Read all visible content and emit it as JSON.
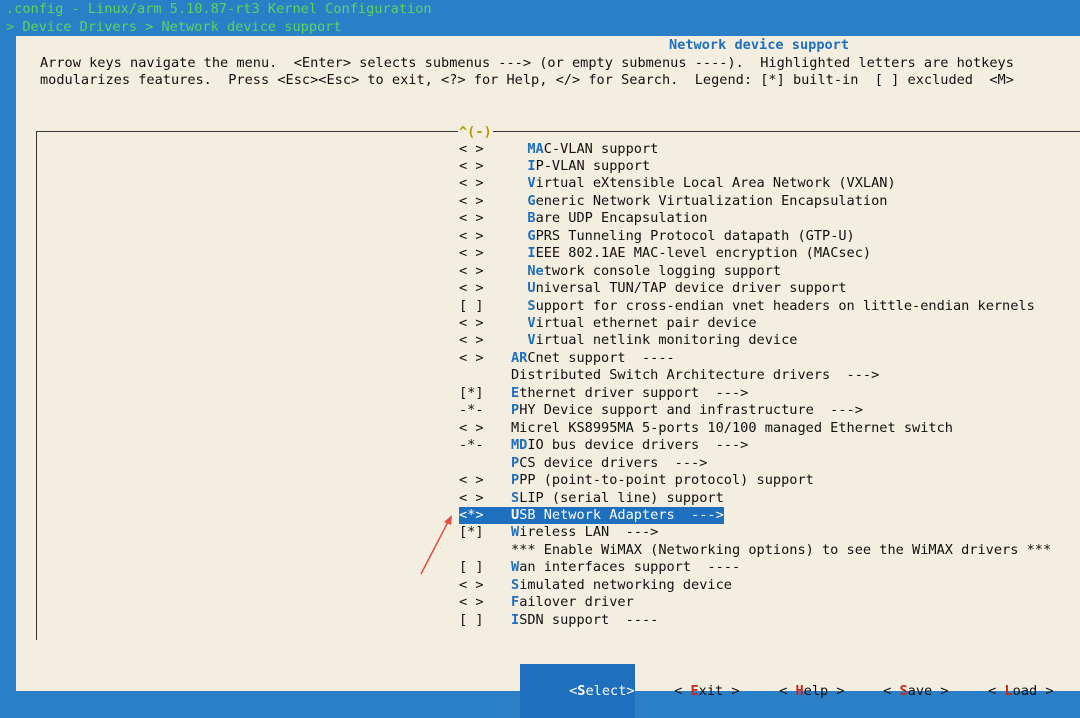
{
  "titlebar": {
    "line1": ".config - Linux/arm 5.10.87-rt3 Kernel Configuration",
    "line2": "> Device Drivers > Network device support"
  },
  "dialog": {
    "title": "Network device support",
    "help_line1": "Arrow keys navigate the menu.  <Enter> selects submenus ---> (or empty submenus ----).  Highlighted letters are hotkeys",
    "help_line2": "modularizes features.  Press <Esc><Esc> to exit, <?> for Help, </> for Search.  Legend: [*] built-in  [ ] excluded  <M>",
    "scroll_indicator": "^(-)"
  },
  "menu": {
    "items": [
      {
        "box": "< >",
        "indent": "  ",
        "hotkey": "MA",
        "rest": "C-VLAN support"
      },
      {
        "box": "< >",
        "indent": "  ",
        "hotkey": "I",
        "rest": "P-VLAN support"
      },
      {
        "box": "< >",
        "indent": "  ",
        "hotkey": "V",
        "rest": "irtual eXtensible Local Area Network (VXLAN)"
      },
      {
        "box": "< >",
        "indent": "  ",
        "hotkey": "G",
        "rest": "eneric Network Virtualization Encapsulation"
      },
      {
        "box": "< >",
        "indent": "  ",
        "hotkey": "B",
        "rest": "are UDP Encapsulation"
      },
      {
        "box": "< >",
        "indent": "  ",
        "hotkey": "G",
        "rest": "PRS Tunneling Protocol datapath (GTP-U)"
      },
      {
        "box": "< >",
        "indent": "  ",
        "hotkey": "I",
        "rest": "EEE 802.1AE MAC-level encryption (MACsec)"
      },
      {
        "box": "< >",
        "indent": "  ",
        "hotkey": "Ne",
        "rest": "twork console logging support"
      },
      {
        "box": "< >",
        "indent": "  ",
        "hotkey": "U",
        "rest": "niversal TUN/TAP device driver support"
      },
      {
        "box": "[ ]",
        "indent": "  ",
        "hotkey": "S",
        "rest": "upport for cross-endian vnet headers on little-endian kernels"
      },
      {
        "box": "< >",
        "indent": "  ",
        "hotkey": "V",
        "rest": "irtual ethernet pair device"
      },
      {
        "box": "< >",
        "indent": "  ",
        "hotkey": "V",
        "rest": "irtual netlink monitoring device"
      },
      {
        "box": "< >",
        "indent": "",
        "hotkey": "AR",
        "rest": "Cnet support  ----"
      },
      {
        "box": "",
        "indent": "",
        "hotkey": "",
        "rest": "Distributed Switch Architecture drivers  --->"
      },
      {
        "box": "[*]",
        "indent": "",
        "hotkey": "E",
        "rest": "thernet driver support  --->"
      },
      {
        "box": "-*-",
        "indent": "",
        "hotkey": "P",
        "rest": "HY Device support and infrastructure  --->"
      },
      {
        "box": "< >",
        "indent": "",
        "hotkey": "",
        "rest": "Micrel KS8995MA 5-ports 10/100 managed Ethernet switch"
      },
      {
        "box": "-*-",
        "indent": "",
        "hotkey": "MD",
        "rest": "IO bus device drivers  --->"
      },
      {
        "box": "",
        "indent": "",
        "hotkey": "P",
        "rest": "CS device drivers  --->"
      },
      {
        "box": "< >",
        "indent": "",
        "hotkey": "P",
        "rest": "PP (point-to-point protocol) support"
      },
      {
        "box": "< >",
        "indent": "",
        "hotkey": "S",
        "rest": "LIP (serial line) support"
      },
      {
        "box": "<*>",
        "indent": "",
        "hotkey": "U",
        "rest": "SB Network Adapters  --->",
        "selected": true
      },
      {
        "box": "[*]",
        "indent": "",
        "hotkey": "W",
        "rest": "ireless LAN  --->"
      },
      {
        "box": "",
        "indent": "",
        "hotkey": "",
        "rest": "*** Enable WiMAX (Networking options) to see the WiMAX drivers ***"
      },
      {
        "box": "[ ]",
        "indent": "",
        "hotkey": "W",
        "rest": "an interfaces support  ----"
      },
      {
        "box": "< >",
        "indent": "",
        "hotkey": "S",
        "rest": "imulated networking device"
      },
      {
        "box": "< >",
        "indent": "",
        "hotkey": "F",
        "rest": "ailover driver"
      },
      {
        "box": "[ ]",
        "indent": "",
        "hotkey": "I",
        "rest": "SDN support  ----"
      }
    ]
  },
  "buttons": [
    {
      "pre": "<",
      "hotkey": "S",
      "post": "elect>",
      "active": true
    },
    {
      "pre": "< ",
      "hotkey": "E",
      "post": "xit >",
      "active": false
    },
    {
      "pre": "< ",
      "hotkey": "H",
      "post": "elp >",
      "active": false
    },
    {
      "pre": "< ",
      "hotkey": "S",
      "post": "ave >",
      "active": false
    },
    {
      "pre": "< ",
      "hotkey": "L",
      "post": "oad >",
      "active": false
    }
  ],
  "colors": {
    "background": "#2b7fc6",
    "dialog": "#f3eee0",
    "hotkey": "#1e6fbe",
    "selected": "#1e6fbe",
    "annotation_arrow": "#e05040"
  },
  "icons": {
    "annotation": "arrow-annotation-icon"
  }
}
